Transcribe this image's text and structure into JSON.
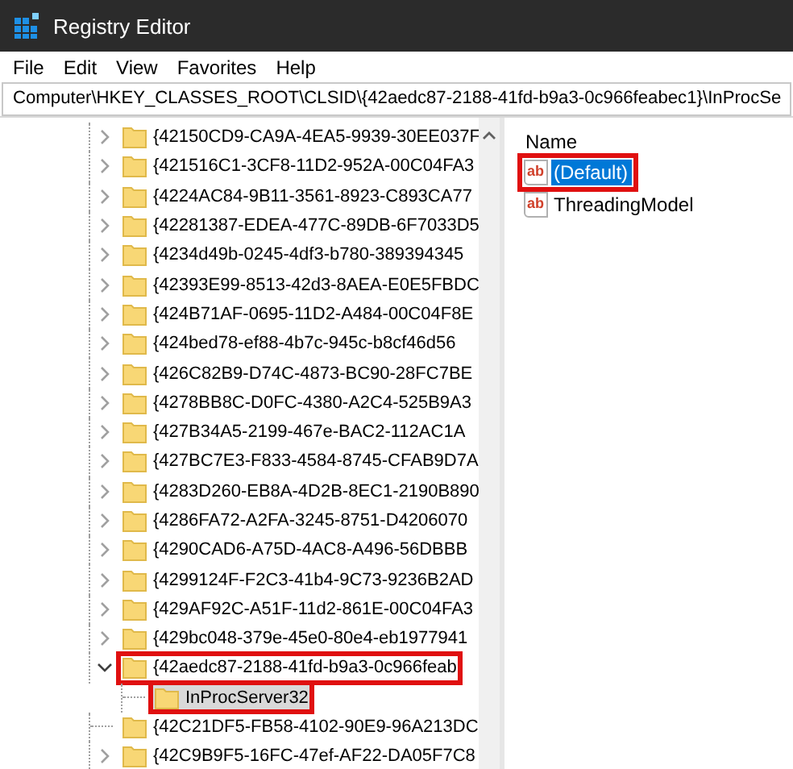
{
  "window": {
    "title": "Registry Editor"
  },
  "menu": [
    "File",
    "Edit",
    "View",
    "Favorites",
    "Help"
  ],
  "address": "Computer\\HKEY_CLASSES_ROOT\\CLSID\\{42aedc87-2188-41fd-b9a3-0c966feabec1}\\InProcSe",
  "tree": [
    {
      "label": "{42150CD9-CA9A-4EA5-9939-30EE037F",
      "has_children": true,
      "expanded": false,
      "selected": false,
      "highlighted": false
    },
    {
      "label": "{421516C1-3CF8-11D2-952A-00C04FA3",
      "has_children": true,
      "expanded": false,
      "selected": false,
      "highlighted": false
    },
    {
      "label": "{4224AC84-9B11-3561-8923-C893CA77",
      "has_children": true,
      "expanded": false,
      "selected": false,
      "highlighted": false
    },
    {
      "label": "{42281387-EDEA-477C-89DB-6F7033D5",
      "has_children": true,
      "expanded": false,
      "selected": false,
      "highlighted": false
    },
    {
      "label": "{4234d49b-0245-4df3-b780-389394345",
      "has_children": true,
      "expanded": false,
      "selected": false,
      "highlighted": false
    },
    {
      "label": "{42393E99-8513-42d3-8AEA-E0E5FBDC",
      "has_children": true,
      "expanded": false,
      "selected": false,
      "highlighted": false
    },
    {
      "label": "{424B71AF-0695-11D2-A484-00C04F8E",
      "has_children": true,
      "expanded": false,
      "selected": false,
      "highlighted": false
    },
    {
      "label": "{424bed78-ef88-4b7c-945c-b8cf46d56",
      "has_children": true,
      "expanded": false,
      "selected": false,
      "highlighted": false
    },
    {
      "label": "{426C82B9-D74C-4873-BC90-28FC7BE",
      "has_children": true,
      "expanded": false,
      "selected": false,
      "highlighted": false
    },
    {
      "label": "{4278BB8C-D0FC-4380-A2C4-525B9A3",
      "has_children": true,
      "expanded": false,
      "selected": false,
      "highlighted": false
    },
    {
      "label": "{427B34A5-2199-467e-BAC2-112AC1A",
      "has_children": true,
      "expanded": false,
      "selected": false,
      "highlighted": false
    },
    {
      "label": "{427BC7E3-F833-4584-8745-CFAB9D7A",
      "has_children": true,
      "expanded": false,
      "selected": false,
      "highlighted": false
    },
    {
      "label": "{4283D260-EB8A-4D2B-8EC1-2190B890",
      "has_children": true,
      "expanded": false,
      "selected": false,
      "highlighted": false
    },
    {
      "label": "{4286FA72-A2FA-3245-8751-D4206070",
      "has_children": true,
      "expanded": false,
      "selected": false,
      "highlighted": false
    },
    {
      "label": "{4290CAD6-A75D-4AC8-A496-56DBBB",
      "has_children": true,
      "expanded": false,
      "selected": false,
      "highlighted": false
    },
    {
      "label": "{4299124F-F2C3-41b4-9C73-9236B2AD",
      "has_children": true,
      "expanded": false,
      "selected": false,
      "highlighted": false
    },
    {
      "label": "{429AF92C-A51F-11d2-861E-00C04FA3",
      "has_children": true,
      "expanded": false,
      "selected": false,
      "highlighted": false
    },
    {
      "label": "{429bc048-379e-45e0-80e4-eb1977941",
      "has_children": true,
      "expanded": false,
      "selected": false,
      "highlighted": false
    },
    {
      "label": "{42aedc87-2188-41fd-b9a3-0c966feab",
      "has_children": true,
      "expanded": true,
      "selected": false,
      "highlighted": true,
      "children": [
        {
          "label": "InProcServer32",
          "has_children": false,
          "selected": true,
          "highlighted": true
        }
      ]
    },
    {
      "label": "{42C21DF5-FB58-4102-90E9-96A213DC",
      "has_children": false,
      "selected": false,
      "highlighted": false
    },
    {
      "label": "{42C9B9F5-16FC-47ef-AF22-DA05F7C8",
      "has_children": true,
      "expanded": false,
      "selected": false,
      "highlighted": false
    }
  ],
  "values": {
    "columns": [
      "Name"
    ],
    "rows": [
      {
        "icon_text": "ab",
        "name": "(Default)",
        "selected": true,
        "highlighted": true
      },
      {
        "icon_text": "ab",
        "name": "ThreadingModel",
        "selected": false,
        "highlighted": false
      }
    ]
  }
}
